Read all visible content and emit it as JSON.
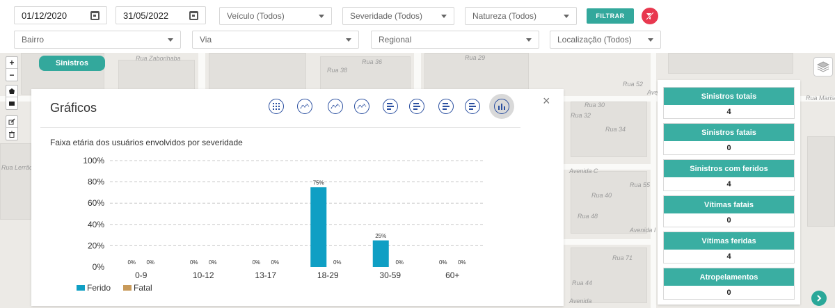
{
  "filters": {
    "date_start": "01/12/2020",
    "date_end": "31/05/2022",
    "veiculo": "Veículo (Todos)",
    "severidade": "Severidade (Todos)",
    "natureza": "Natureza (Todos)",
    "bairro": "Bairro",
    "via": "Via",
    "regional": "Regional",
    "localizacao": "Localização (Todos)",
    "filter_button": "FILTRAR"
  },
  "map": {
    "tab_label": "Sinistros",
    "zoom_in": "+",
    "zoom_out": "−",
    "street_labels": [
      "Rua Zaborihaba",
      "Rua 38",
      "Rua 36",
      "Rua 29",
      "Avenida C",
      "Rua 40",
      "Rua 32",
      "Rua 34",
      "Rua 48",
      "Avenida I",
      "Rua 71",
      "Rua 52",
      "Avenida",
      "Rua 30",
      "Rua 55",
      "Rua 44",
      "Avenida",
      "Rua Lerrão",
      "Rua Marise"
    ]
  },
  "panel": {
    "title": "Gráficos",
    "close": "×",
    "chart_icons": [
      "grid-chart-icon",
      "line-chart-icon",
      "line-chart-icon",
      "line-chart-icon",
      "bar-horizontal-icon",
      "bar-horizontal-icon",
      "bar-horizontal-icon",
      "bar-horizontal-icon",
      "column-chart-icon"
    ],
    "chart_title": "Faixa etária dos usuários envolvidos por severidade"
  },
  "chart_data": {
    "type": "bar",
    "title": "Faixa etária dos usuários envolvidos por severidade",
    "categories": [
      "0-9",
      "10-12",
      "13-17",
      "18-29",
      "30-59",
      "60+"
    ],
    "series": [
      {
        "name": "Ferido",
        "color": "#0f9fc4",
        "values": [
          0,
          0,
          0,
          75,
          25,
          0
        ]
      },
      {
        "name": "Fatal",
        "color": "#c89a5a",
        "values": [
          0,
          0,
          0,
          0,
          0,
          0
        ]
      }
    ],
    "ylim": [
      0,
      100
    ],
    "yticks": [
      "0%",
      "20%",
      "40%",
      "60%",
      "80%",
      "100%"
    ],
    "grid": true,
    "legend": "bottom-left"
  },
  "stats": [
    {
      "label": "Sinistros totais",
      "value": "4"
    },
    {
      "label": "Sinistros fatais",
      "value": "0"
    },
    {
      "label": "Sinistros com feridos",
      "value": "4"
    },
    {
      "label": "Vítimas fatais",
      "value": "0"
    },
    {
      "label": "Vítimas feridas",
      "value": "4"
    },
    {
      "label": "Atropelamentos",
      "value": "0"
    }
  ],
  "colors": {
    "accent": "#33a89c",
    "danger": "#e8384f",
    "icon": "#2a4fa0"
  }
}
